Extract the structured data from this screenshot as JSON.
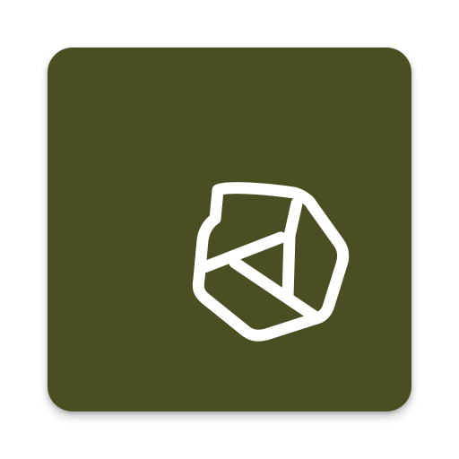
{
  "app_icon": {
    "name": "hexagon-shield-logo-icon",
    "background_color": "#4a4e22",
    "foreground_color": "#ffffff"
  }
}
